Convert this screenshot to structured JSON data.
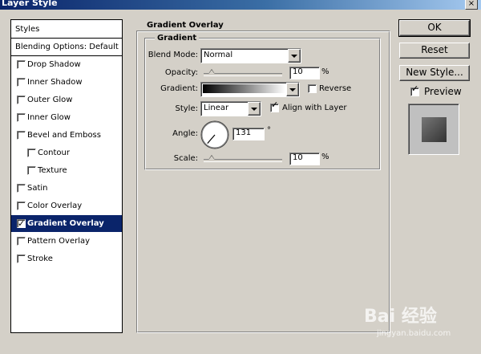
{
  "window": {
    "title": "Layer Style",
    "close_glyph": "×"
  },
  "left_panel": {
    "items": [
      {
        "label": "Styles",
        "has_checkbox": false,
        "checked": false,
        "selected": false,
        "indent": false,
        "separator": true
      },
      {
        "label": "Blending Options: Default",
        "has_checkbox": false,
        "checked": false,
        "selected": false,
        "indent": false,
        "separator": true
      },
      {
        "label": "Drop Shadow",
        "has_checkbox": true,
        "checked": false,
        "selected": false,
        "indent": false
      },
      {
        "label": "Inner Shadow",
        "has_checkbox": true,
        "checked": false,
        "selected": false,
        "indent": false
      },
      {
        "label": "Outer Glow",
        "has_checkbox": true,
        "checked": false,
        "selected": false,
        "indent": false
      },
      {
        "label": "Inner Glow",
        "has_checkbox": true,
        "checked": false,
        "selected": false,
        "indent": false
      },
      {
        "label": "Bevel and Emboss",
        "has_checkbox": true,
        "checked": false,
        "selected": false,
        "indent": false
      },
      {
        "label": "Contour",
        "has_checkbox": true,
        "checked": false,
        "selected": false,
        "indent": true
      },
      {
        "label": "Texture",
        "has_checkbox": true,
        "checked": false,
        "selected": false,
        "indent": true
      },
      {
        "label": "Satin",
        "has_checkbox": true,
        "checked": false,
        "selected": false,
        "indent": false
      },
      {
        "label": "Color Overlay",
        "has_checkbox": true,
        "checked": false,
        "selected": false,
        "indent": false
      },
      {
        "label": "Gradient Overlay",
        "has_checkbox": true,
        "checked": true,
        "selected": true,
        "indent": false
      },
      {
        "label": "Pattern Overlay",
        "has_checkbox": true,
        "checked": false,
        "selected": false,
        "indent": false
      },
      {
        "label": "Stroke",
        "has_checkbox": true,
        "checked": false,
        "selected": false,
        "indent": false
      }
    ]
  },
  "gradient_overlay": {
    "section_title": "Gradient Overlay",
    "group_title": "Gradient",
    "blend_mode": {
      "label": "Blend Mode:",
      "value": "Normal"
    },
    "opacity": {
      "label": "Opacity:",
      "value": "10",
      "unit": "%",
      "level_percent": 10
    },
    "gradient": {
      "label": "Gradient:",
      "reverse_label": "Reverse",
      "reverse_checked": false,
      "colors": [
        "#000000",
        "#ffffff"
      ]
    },
    "style": {
      "label": "Style:",
      "value": "Linear",
      "align_label": "Align with Layer",
      "align_checked": true
    },
    "angle": {
      "label": "Angle:",
      "value": "131",
      "unit": "°",
      "degrees": 131
    },
    "scale": {
      "label": "Scale:",
      "value": "10",
      "unit": "%",
      "level_percent": 10
    }
  },
  "buttons": {
    "ok": "OK",
    "reset": "Reset",
    "new_style": "New Style..."
  },
  "preview": {
    "label": "Preview",
    "checked": true
  },
  "watermark": {
    "text": "Bai 经验",
    "subtext": "jingyan.baidu.com"
  }
}
